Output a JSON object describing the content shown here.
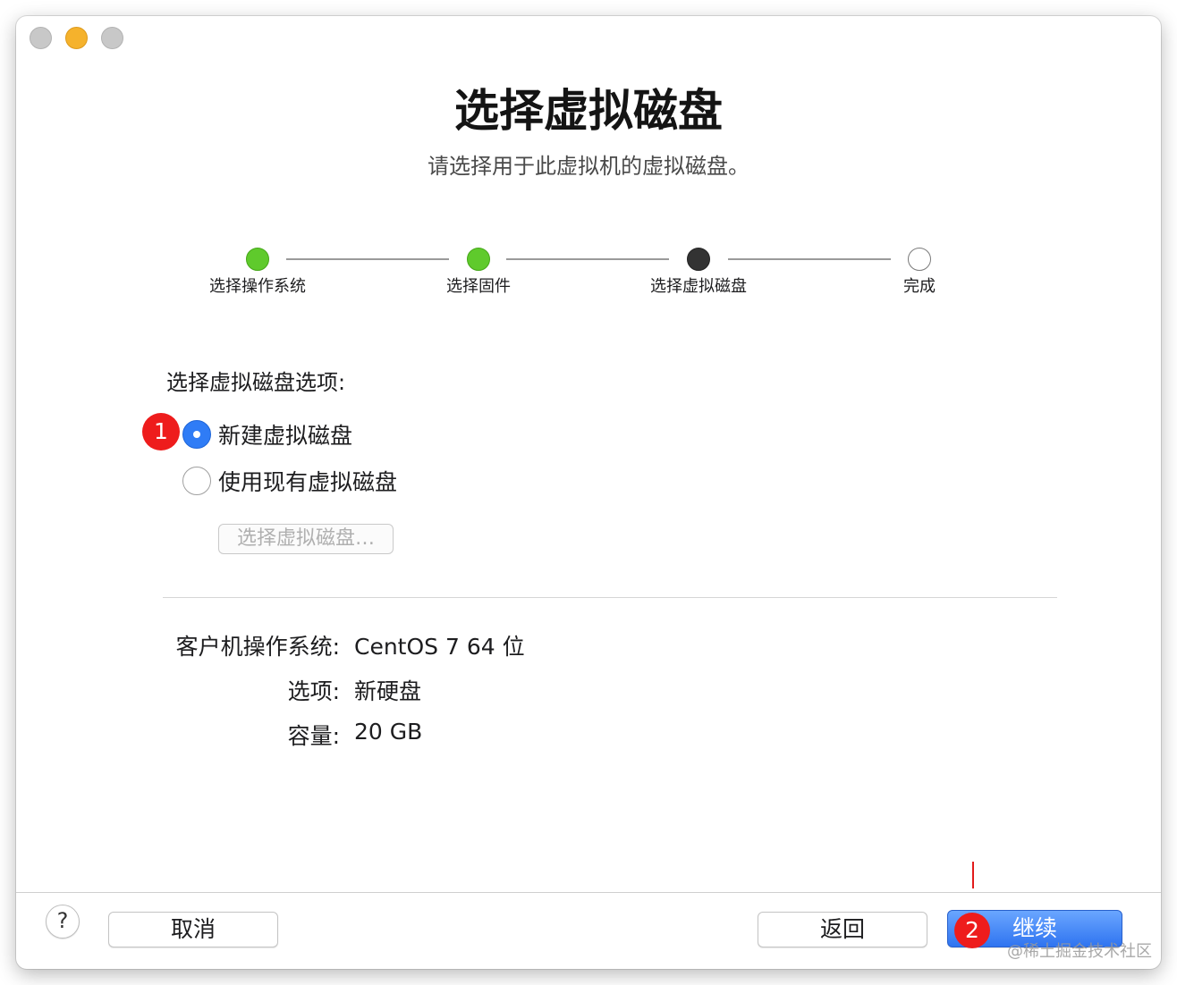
{
  "window": {
    "title": "选择虚拟磁盘",
    "subtitle": "请选择用于此虚拟机的虚拟磁盘。"
  },
  "steps": [
    {
      "label": "选择操作系统",
      "state": "done"
    },
    {
      "label": "选择固件",
      "state": "done"
    },
    {
      "label": "选择虚拟磁盘",
      "state": "current"
    },
    {
      "label": "完成",
      "state": "pending"
    }
  ],
  "options": {
    "section_label": "选择虚拟磁盘选项:",
    "new_disk_label": "新建虚拟磁盘",
    "new_disk_selected": true,
    "existing_disk_label": "使用现有虚拟磁盘",
    "existing_disk_selected": false,
    "choose_disk_button": "选择虚拟磁盘…"
  },
  "summary": [
    {
      "key": "客户机操作系统:",
      "value": "CentOS 7 64 位"
    },
    {
      "key": "选项:",
      "value": "新硬盘"
    },
    {
      "key": "容量:",
      "value": "20 GB"
    }
  ],
  "footer": {
    "help": "?",
    "cancel": "取消",
    "back": "返回",
    "continue": "继续"
  },
  "annotations": {
    "badge1": "1",
    "badge2": "2",
    "watermark": "@稀土掘金技术社区"
  },
  "colors": {
    "step_done": "#5fca2c",
    "step_current": "#333333",
    "accent": "#2f7cf6",
    "annotation_red": "#ee1c1c"
  }
}
